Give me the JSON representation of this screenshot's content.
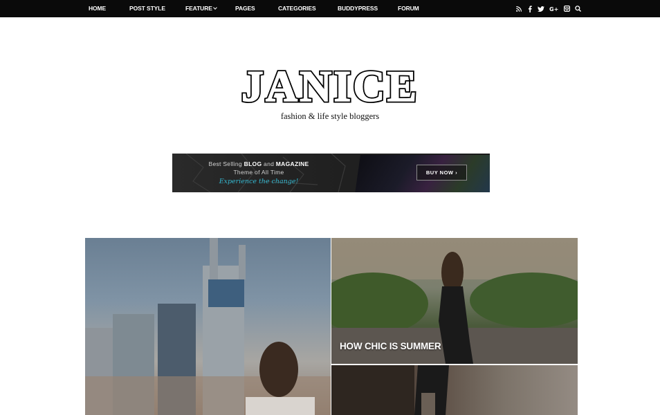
{
  "nav": {
    "items": [
      {
        "label": "HOME"
      },
      {
        "label": "POST STYLE"
      },
      {
        "label": "FEATURE",
        "has_dropdown": true
      },
      {
        "label": "PAGES"
      },
      {
        "label": "CATEGORIES"
      },
      {
        "label": "BUDDYPRESS"
      },
      {
        "label": "FORUM"
      }
    ],
    "social_icons": [
      "rss-icon",
      "facebook-icon",
      "twitter-icon",
      "google-plus-icon",
      "instagram-icon",
      "search-icon"
    ]
  },
  "site": {
    "logo": "JANICE",
    "tagline": "fashion & life style bloggers"
  },
  "banner": {
    "line1_prefix": "Best Selling ",
    "line1_bold1": "BLOG",
    "line1_mid": " and ",
    "line1_bold2": "MAGAZINE",
    "line2": "Theme of All Time",
    "line3": "Experience the change!",
    "button": "BUY NOW ›",
    "accent": "#35b7cf"
  },
  "featured": {
    "top_right_title": "HOW CHIC IS SUMMER"
  },
  "colors": {
    "topbar": "#0a0a0a",
    "background": "#ffffff"
  }
}
